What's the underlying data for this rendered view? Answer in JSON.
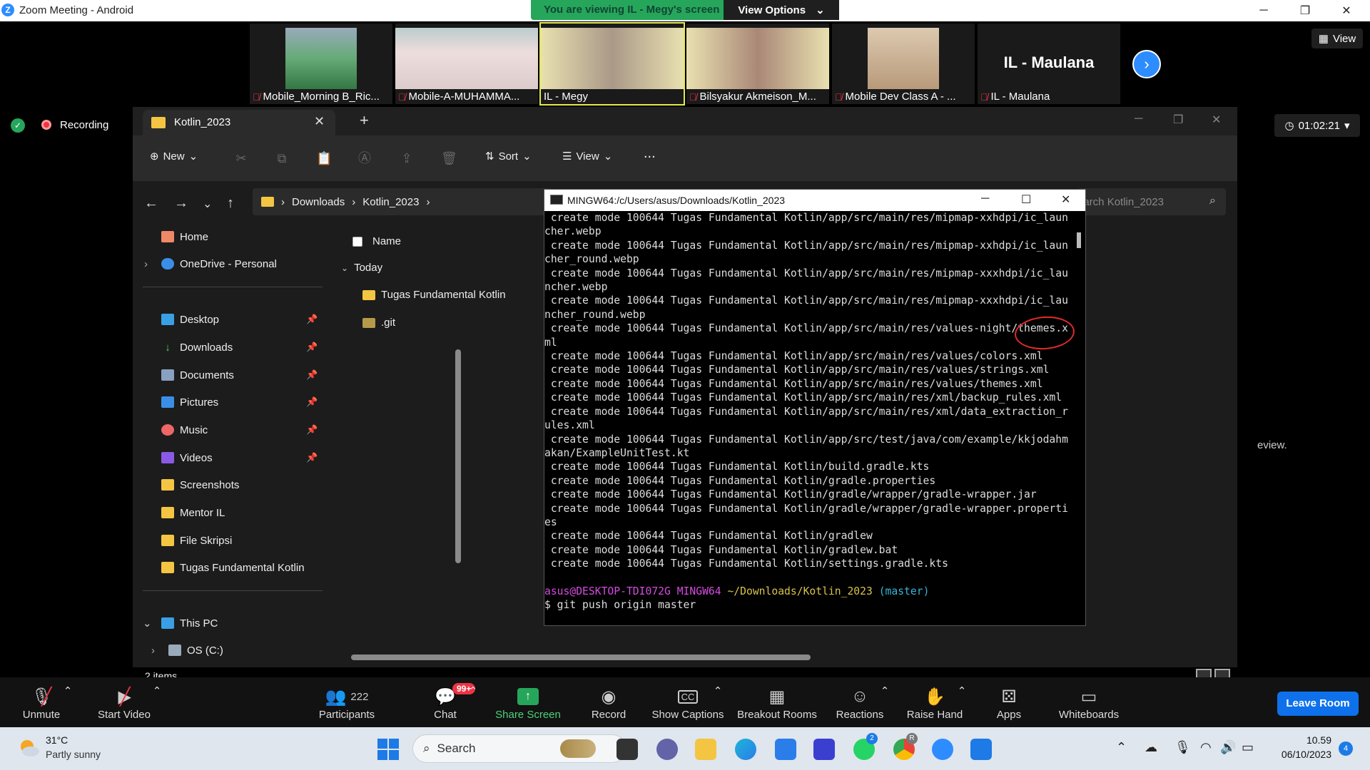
{
  "zoom": {
    "window_title": "Zoom Meeting - Android",
    "banner_text": "You are viewing IL - Megy's screen",
    "view_options_label": "View Options",
    "view_label": "View",
    "recording_label": "Recording",
    "timer": "01:02:21",
    "participants": [
      {
        "name": "Mobile_Morning B_Ric...",
        "muted": true
      },
      {
        "name": "Mobile-A-MUHAMMA...",
        "muted": true
      },
      {
        "name": "IL - Megy",
        "muted": false,
        "active": true
      },
      {
        "name": "Bilsyakur Akmeison_M...",
        "muted": true
      },
      {
        "name": "Mobile Dev Class A - ...",
        "muted": true
      },
      {
        "name": "IL - Maulana",
        "muted": true,
        "big_name": "IL - Maulana"
      }
    ],
    "toolbar": {
      "unmute": "Unmute",
      "start_video": "Start Video",
      "participants_count": "222",
      "participants": "Participants",
      "chat": "Chat",
      "chat_badge": "99+",
      "share_screen": "Share Screen",
      "record": "Record",
      "show_captions": "Show Captions",
      "breakout_rooms": "Breakout Rooms",
      "reactions": "Reactions",
      "raise_hand": "Raise Hand",
      "apps": "Apps",
      "whiteboards": "Whiteboards",
      "leave_room": "Leave Room"
    },
    "accent_color": "#2d8cff",
    "share_color": "#26a65b"
  },
  "explorer": {
    "tab_title": "Kotlin_2023",
    "toolbar": {
      "new": "New",
      "sort": "Sort",
      "view": "View",
      "more": "..."
    },
    "breadcrumb": [
      "Downloads",
      "Kotlin_2023"
    ],
    "search_placeholder": "earch Kotlin_2023",
    "sidebar": {
      "home": "Home",
      "onedrive": "OneDrive - Personal",
      "pinned": [
        "Desktop",
        "Downloads",
        "Documents",
        "Pictures",
        "Music",
        "Videos"
      ],
      "folders": [
        "Screenshots",
        "Mentor IL",
        "File Skripsi",
        "Tugas Fundamental Kotlin"
      ],
      "this_pc": "This PC",
      "os_drive": "OS (C:)"
    },
    "list": {
      "column_name": "Name",
      "group": "Today",
      "items": [
        "Tugas Fundamental Kotlin",
        ".git"
      ]
    },
    "status_items": "2 items",
    "preview_text": "eview."
  },
  "terminal": {
    "title": "MINGW64:/c/Users/asus/Downloads/Kotlin_2023",
    "lines": [
      " create mode 100644 Tugas Fundamental Kotlin/app/src/main/res/mipmap-xxhdpi/ic_laun",
      "cher.webp",
      " create mode 100644 Tugas Fundamental Kotlin/app/src/main/res/mipmap-xxhdpi/ic_laun",
      "cher_round.webp",
      " create mode 100644 Tugas Fundamental Kotlin/app/src/main/res/mipmap-xxxhdpi/ic_lau",
      "ncher.webp",
      " create mode 100644 Tugas Fundamental Kotlin/app/src/main/res/mipmap-xxxhdpi/ic_lau",
      "ncher_round.webp",
      " create mode 100644 Tugas Fundamental Kotlin/app/src/main/res/values-night/themes.x",
      "ml",
      " create mode 100644 Tugas Fundamental Kotlin/app/src/main/res/values/colors.xml",
      " create mode 100644 Tugas Fundamental Kotlin/app/src/main/res/values/strings.xml",
      " create mode 100644 Tugas Fundamental Kotlin/app/src/main/res/values/themes.xml",
      " create mode 100644 Tugas Fundamental Kotlin/app/src/main/res/xml/backup_rules.xml",
      " create mode 100644 Tugas Fundamental Kotlin/app/src/main/res/xml/data_extraction_r",
      "ules.xml",
      " create mode 100644 Tugas Fundamental Kotlin/app/src/test/java/com/example/kkjodahm",
      "akan/ExampleUnitTest.kt",
      " create mode 100644 Tugas Fundamental Kotlin/build.gradle.kts",
      " create mode 100644 Tugas Fundamental Kotlin/gradle.properties",
      " create mode 100644 Tugas Fundamental Kotlin/gradle/wrapper/gradle-wrapper.jar",
      " create mode 100644 Tugas Fundamental Kotlin/gradle/wrapper/gradle-wrapper.properti",
      "es",
      " create mode 100644 Tugas Fundamental Kotlin/gradlew",
      " create mode 100644 Tugas Fundamental Kotlin/gradlew.bat",
      " create mode 100644 Tugas Fundamental Kotlin/settings.gradle.kts",
      ""
    ],
    "prompt_user": "asus@DESKTOP-TDI072G",
    "prompt_host": "MINGW64",
    "prompt_path": "~/Downloads/Kotlin_2023",
    "prompt_branch": "(master)",
    "command": "$ git push origin master"
  },
  "taskbar": {
    "weather_temp": "31°C",
    "weather_desc": "Partly sunny",
    "search_label": "Search",
    "time": "10.59",
    "date": "06/10/2023",
    "notifications": "4",
    "whatsapp_badge": "2",
    "chrome_badge": "R"
  }
}
